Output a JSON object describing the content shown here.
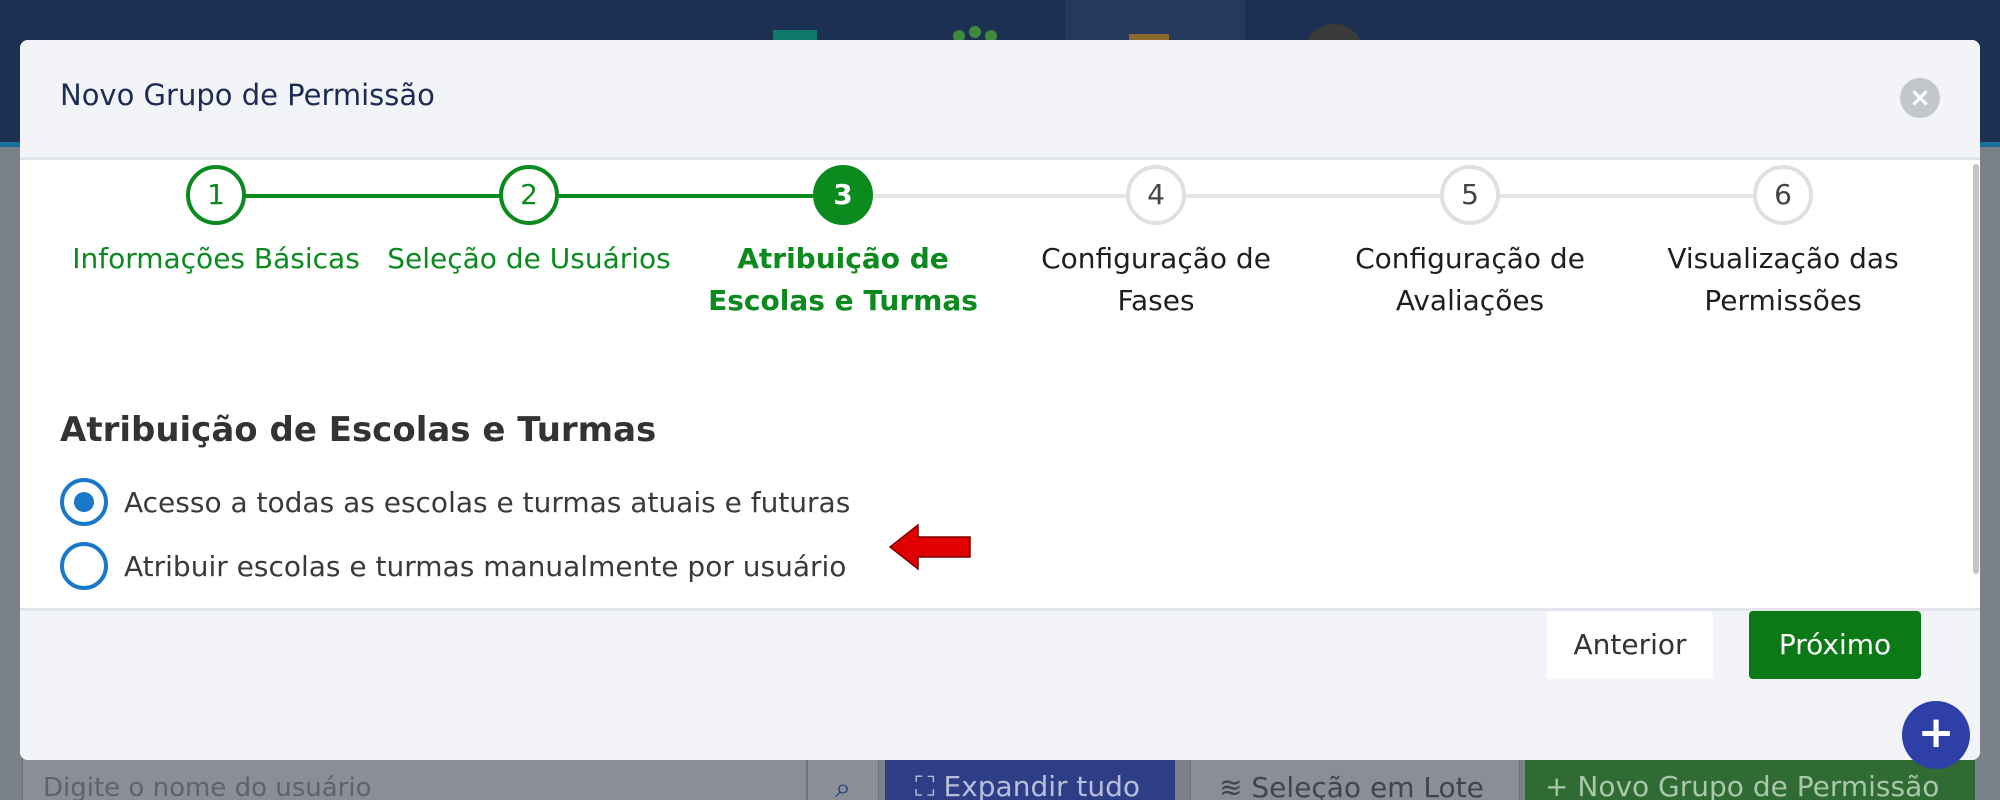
{
  "background": {
    "search_placeholder": "Digite o nome do usuário",
    "expand_label": "Expandir tudo",
    "bulk_select_label": "Seleção em Lote",
    "new_group_label": "Novo Grupo de Permissão"
  },
  "modal": {
    "title": "Novo Grupo de Permissão",
    "close_icon": "×",
    "steps": [
      {
        "number": "1",
        "label": "Informações Básicas",
        "state": "done"
      },
      {
        "number": "2",
        "label": "Seleção de Usuários",
        "state": "done"
      },
      {
        "number": "3",
        "label": "Atribuição de Escolas e Turmas",
        "state": "active"
      },
      {
        "number": "4",
        "label": "Configuração de Fases",
        "state": "pending"
      },
      {
        "number": "5",
        "label": "Configuração de Avaliações",
        "state": "pending"
      },
      {
        "number": "6",
        "label": "Visualização das Permissões",
        "state": "pending"
      }
    ],
    "section_title": "Atribuição de Escolas e Turmas",
    "options": [
      {
        "label": "Acesso a todas as escolas e turmas atuais e futuras",
        "selected": true
      },
      {
        "label": "Atribuir escolas e turmas manualmente por usuário",
        "selected": false
      }
    ],
    "prev_button": "Anterior",
    "next_button": "Próximo"
  },
  "fab_icon": "+",
  "colors": {
    "accent_green": "#0b8a1e",
    "radio_blue": "#1a78c8",
    "annotation_arrow": "#e00000",
    "fab": "#2f3fa8"
  }
}
